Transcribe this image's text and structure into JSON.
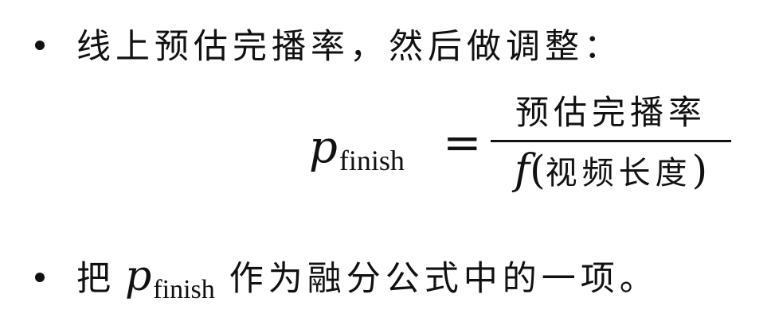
{
  "bullet1": {
    "text": "线上预估完播率，然后做调整："
  },
  "equation": {
    "lhs_symbol": "p",
    "lhs_subscript": "finish",
    "equals": "=",
    "numerator": "预估完播率",
    "denominator_function": "f",
    "denominator_open": "(",
    "denominator_text": "视频长度",
    "denominator_close": ")"
  },
  "bullet2": {
    "prefix": "把",
    "symbol": "p",
    "subscript": "finish",
    "suffix": "作为融分公式中的一项。"
  }
}
